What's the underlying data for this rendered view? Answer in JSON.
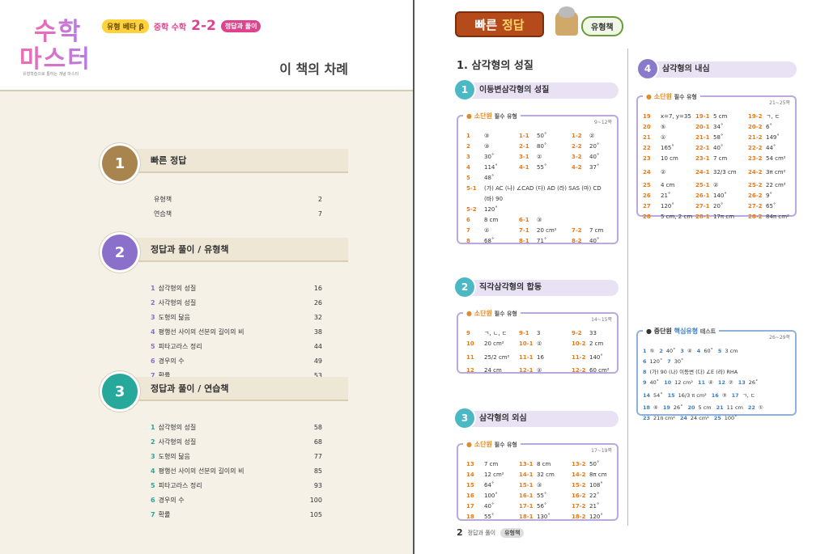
{
  "left": {
    "logo": {
      "line1": "수학",
      "line2": "마스터",
      "tag": "유형학습으로 통하는 개념 마스터"
    },
    "series": "유형 베타 β",
    "subject": "중학 수학",
    "grade": "2-2",
    "badge": "정답과 풀이",
    "toc_title": "이 책의 차례",
    "sections": [
      {
        "num": "1",
        "title": "빠른 정답",
        "color": "#a8854e",
        "items": [
          {
            "n": "",
            "label": "유형책",
            "page": "2"
          },
          {
            "n": "",
            "label": "연습책",
            "page": "7"
          }
        ]
      },
      {
        "num": "2",
        "title": "정답과 풀이 / 유형책",
        "color": "#8a6fcb",
        "items": [
          {
            "n": "1",
            "label": "삼각형의 성질",
            "page": "16"
          },
          {
            "n": "2",
            "label": "사각형의 성질",
            "page": "26"
          },
          {
            "n": "3",
            "label": "도형의 닮음",
            "page": "32"
          },
          {
            "n": "4",
            "label": "평행선 사이의 선분의 길이의 비",
            "page": "38"
          },
          {
            "n": "5",
            "label": "피타고라스 정리",
            "page": "44"
          },
          {
            "n": "6",
            "label": "경우의 수",
            "page": "49"
          },
          {
            "n": "7",
            "label": "확률",
            "page": "53"
          }
        ]
      },
      {
        "num": "3",
        "title": "정답과 풀이 / 연습책",
        "color": "#26a89a",
        "items": [
          {
            "n": "1",
            "label": "삼각형의 성질",
            "page": "58"
          },
          {
            "n": "2",
            "label": "사각형의 성질",
            "page": "68"
          },
          {
            "n": "3",
            "label": "도형의 닮음",
            "page": "77"
          },
          {
            "n": "4",
            "label": "평행선 사이의 선분의 길이의 비",
            "page": "85"
          },
          {
            "n": "5",
            "label": "피타고라스 정리",
            "page": "93"
          },
          {
            "n": "6",
            "label": "경우의 수",
            "page": "100"
          },
          {
            "n": "7",
            "label": "확률",
            "page": "105"
          }
        ]
      }
    ]
  },
  "right": {
    "banner_a": "빠른",
    "banner_b": "정답",
    "book": "유형책",
    "chapter": "1. 삼각형의 성질",
    "s1": {
      "num": "1",
      "title": "이등변삼각형의 성질",
      "box": "소단원",
      "kind": "필수 유형",
      "range": "9~12쪽",
      "rows": [
        [
          [
            "1",
            "③"
          ],
          [
            "1-1",
            "50˚"
          ],
          [
            "1-2",
            "②"
          ]
        ],
        [
          [
            "2",
            "③"
          ],
          [
            "2-1",
            "80˚"
          ],
          [
            "2-2",
            "20˚"
          ]
        ],
        [
          [
            "3",
            "30˚"
          ],
          [
            "3-1",
            "②"
          ],
          [
            "3-2",
            "40˚"
          ]
        ],
        [
          [
            "4",
            "114˚"
          ],
          [
            "4-1",
            "55˚"
          ],
          [
            "4-2",
            "37˚"
          ]
        ],
        [
          [
            "5",
            "48˚"
          ]
        ],
        [
          [
            "5-1",
            "(가) AC   (나) ∠CAD   (다) AD   (라) SAS   (마) CD"
          ]
        ],
        [
          [
            "",
            "(바) 90"
          ]
        ],
        [
          [
            "5-2",
            "120˚"
          ]
        ],
        [
          [
            "6",
            "8 cm"
          ],
          [
            "6-1",
            "③"
          ]
        ],
        [
          [
            "7",
            "②"
          ],
          [
            "7-1",
            "20 cm²"
          ],
          [
            "7-2",
            "7 cm"
          ]
        ],
        [
          [
            "8",
            "68˚"
          ],
          [
            "8-1",
            "71˚"
          ],
          [
            "8-2",
            "40˚"
          ]
        ]
      ]
    },
    "s2": {
      "num": "2",
      "title": "직각삼각형의 합동",
      "box": "소단원",
      "kind": "필수 유형",
      "range": "14~15쪽",
      "rows": [
        [
          [
            "9",
            "ㄱ, ㄴ, ㄷ"
          ],
          [
            "9-1",
            "3"
          ],
          [
            "9-2",
            "33"
          ]
        ],
        [
          [
            "10",
            "20 cm²"
          ],
          [
            "10-1",
            "①"
          ],
          [
            "10-2",
            "2 cm"
          ]
        ],
        [
          [
            "11",
            "25/2 cm²"
          ],
          [
            "11-1",
            "16"
          ],
          [
            "11-2",
            "140˚"
          ]
        ],
        [
          [
            "12",
            "24 cm"
          ],
          [
            "12-1",
            "②"
          ],
          [
            "12-2",
            "60 cm²"
          ]
        ]
      ]
    },
    "s3": {
      "num": "3",
      "title": "삼각형의 외심",
      "box": "소단원",
      "kind": "필수 유형",
      "range": "17~19쪽",
      "rows": [
        [
          [
            "13",
            "7 cm"
          ],
          [
            "13-1",
            "8 cm"
          ],
          [
            "13-2",
            "50˚"
          ]
        ],
        [
          [
            "14",
            "12 cm²"
          ],
          [
            "14-1",
            "32 cm"
          ],
          [
            "14-2",
            "8π cm"
          ]
        ],
        [
          [
            "15",
            "64˚"
          ],
          [
            "15-1",
            "③"
          ],
          [
            "15-2",
            "108˚"
          ]
        ],
        [
          [
            "16",
            "100˚"
          ],
          [
            "16-1",
            "55˚"
          ],
          [
            "16-2",
            "22˚"
          ]
        ],
        [
          [
            "17",
            "40˚"
          ],
          [
            "17-1",
            "56˚"
          ],
          [
            "17-2",
            "21˚"
          ]
        ],
        [
          [
            "18",
            "55˚"
          ],
          [
            "18-1",
            "130˚"
          ],
          [
            "18-2",
            "120˚"
          ]
        ]
      ]
    },
    "s4": {
      "num": "4",
      "title": "삼각형의 내심",
      "box": "소단원",
      "kind": "필수 유형",
      "range": "21~25쪽",
      "rows": [
        [
          [
            "19",
            "x=7, y=35"
          ],
          [
            "19-1",
            "5 cm"
          ],
          [
            "19-2",
            "ㄱ, ㄷ"
          ]
        ],
        [
          [
            "20",
            "⑤"
          ],
          [
            "20-1",
            "34˚"
          ],
          [
            "20-2",
            "6˚"
          ]
        ],
        [
          [
            "21",
            "①"
          ],
          [
            "21-1",
            "58˚"
          ],
          [
            "21-2",
            "149˚"
          ]
        ],
        [
          [
            "22",
            "165˚"
          ],
          [
            "22-1",
            "40˚"
          ],
          [
            "22-2",
            "44˚"
          ]
        ],
        [
          [
            "23",
            "10 cm"
          ],
          [
            "23-1",
            "7 cm"
          ],
          [
            "23-2",
            "54 cm²"
          ]
        ],
        [
          [
            "24",
            "②"
          ],
          [
            "24-1",
            "32/3 cm"
          ],
          [
            "24-2",
            "3π cm²"
          ]
        ],
        [
          [
            "25",
            "4 cm"
          ],
          [
            "25-1",
            "②"
          ],
          [
            "25-2",
            "22 cm²"
          ]
        ],
        [
          [
            "26",
            "21˚"
          ],
          [
            "26-1",
            "140˚"
          ],
          [
            "26-2",
            "9˚"
          ]
        ],
        [
          [
            "27",
            "120˚"
          ],
          [
            "27-1",
            "20˚"
          ],
          [
            "27-2",
            "65˚"
          ]
        ],
        [
          [
            "28",
            "5 cm, 2 cm"
          ],
          [
            "28-1",
            "17π cm"
          ],
          [
            "28-2",
            "84π cm²"
          ]
        ]
      ]
    },
    "mid": {
      "box": "중단원",
      "accent": "핵심유형",
      "kind": "테스트",
      "range": "26~29쪽",
      "rows": [
        [
          [
            "1",
            "⑤"
          ],
          [
            "2",
            "40˚"
          ],
          [
            "3",
            "④"
          ],
          [
            "4",
            "60˚"
          ],
          [
            "5",
            "3 cm"
          ]
        ],
        [
          [
            "6",
            "120˚"
          ],
          [
            "7",
            "30˚"
          ]
        ],
        [
          [
            "8",
            "(가) 90   (나) 이등변   (다) ∠E   (라) RHA"
          ]
        ],
        [
          [
            "9",
            "40˚"
          ],
          [
            "10",
            "12 cm²"
          ],
          [
            "11",
            "④"
          ],
          [
            "12",
            "②"
          ],
          [
            "13",
            "26˚"
          ]
        ],
        [
          [
            "14",
            "54˚"
          ],
          [
            "15",
            "16/3 π cm²"
          ],
          [
            "16",
            "③"
          ],
          [
            "17",
            "ㄱ, ㄷ"
          ]
        ],
        [
          [
            "18",
            "④"
          ],
          [
            "19",
            "26˚"
          ],
          [
            "20",
            "5 cm"
          ],
          [
            "21",
            "11 cm"
          ],
          [
            "22",
            "①"
          ]
        ],
        [
          [
            "23",
            "21π cm²"
          ],
          [
            "24",
            "24 cm²"
          ],
          [
            "25",
            "100˚"
          ]
        ]
      ]
    },
    "footer": {
      "page": "2",
      "label": "정답과 풀이",
      "pill": "유형책"
    }
  }
}
